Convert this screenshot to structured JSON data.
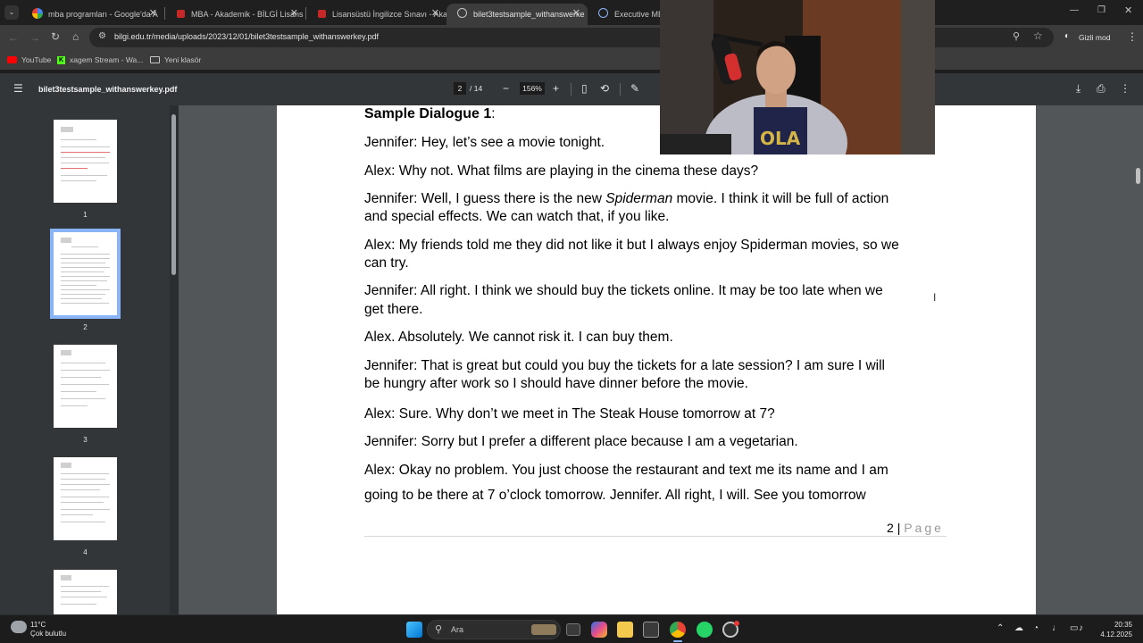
{
  "tabs": [
    {
      "title": "mba programları - Google'da A",
      "active": false
    },
    {
      "title": "MBA - Akademik - BİLGİ Lisans",
      "active": false
    },
    {
      "title": "Lisansüstü İngilizce Sınavı - Aka",
      "active": false
    },
    {
      "title": "bilet3testsample_withanswerke",
      "active": true
    },
    {
      "title": "Executive MBA |",
      "active": false
    }
  ],
  "address": {
    "url": "bilgi.edu.tr/media/uploads/2023/12/01/bilet3testsample_withanswerkey.pdf",
    "profile_label": "Gizli mod"
  },
  "bookmarks": [
    {
      "label": "YouTube"
    },
    {
      "label": "xagem Stream - Wa..."
    },
    {
      "label": "Yeni klasör"
    }
  ],
  "pdf_toolbar": {
    "file_name": "bilet3testsample_withanswerkey.pdf",
    "current_page": "2",
    "page_total": "/ 14",
    "zoom": "156%"
  },
  "thumbnails": [
    {
      "number": "1",
      "selected": false
    },
    {
      "number": "2",
      "selected": true
    },
    {
      "number": "3",
      "selected": false
    },
    {
      "number": "4",
      "selected": false
    }
  ],
  "document": {
    "heading": "Sample Dialogue 1",
    "heading_suffix": ":",
    "lines": [
      "Jennifer: Hey, let’s see a movie tonight.",
      "Alex: Why not. What films are playing in the cinema these days?",
      {
        "before": "Jennifer: Well, I guess there is the new ",
        "italic": "Spiderman",
        "after": " movie. I think it will be full of action"
      },
      "and special effects. We can watch that, if you like.",
      "Alex: My friends told me they did not like it but I always enjoy Spiderman movies, so we",
      "can try.",
      "Jennifer: All right. I think we should buy the tickets online. It may be too late when we",
      "get there.",
      "Alex. Absolutely. We cannot risk it. I can buy them.",
      "Jennifer: That is great but could you buy the tickets for a late session? I am sure I will",
      "be hungry after work so I should have dinner before the movie.",
      "Alex: Sure. Why don’t we meet in The Steak House tomorrow at 7?",
      "Jennifer: Sorry but I prefer a different place because I am a vegetarian.",
      "Alex: Okay no problem. You just choose the restaurant and text me its name and I am",
      "going to be there at 7 o’clock tomorrow. Jennifer. All right, I will. See you tomorrow"
    ],
    "page_number": "2",
    "page_separator": "|",
    "page_word": "Page"
  },
  "taskbar": {
    "weather_temp": "11°C",
    "weather_desc": "Çok bulutlu",
    "search_placeholder": "Ara",
    "time": "20:35",
    "date": "4.12.2025"
  },
  "colors": {
    "accent": "#8ab4f8",
    "viewer_bg": "#525659",
    "toolbar_bg": "#323639"
  }
}
